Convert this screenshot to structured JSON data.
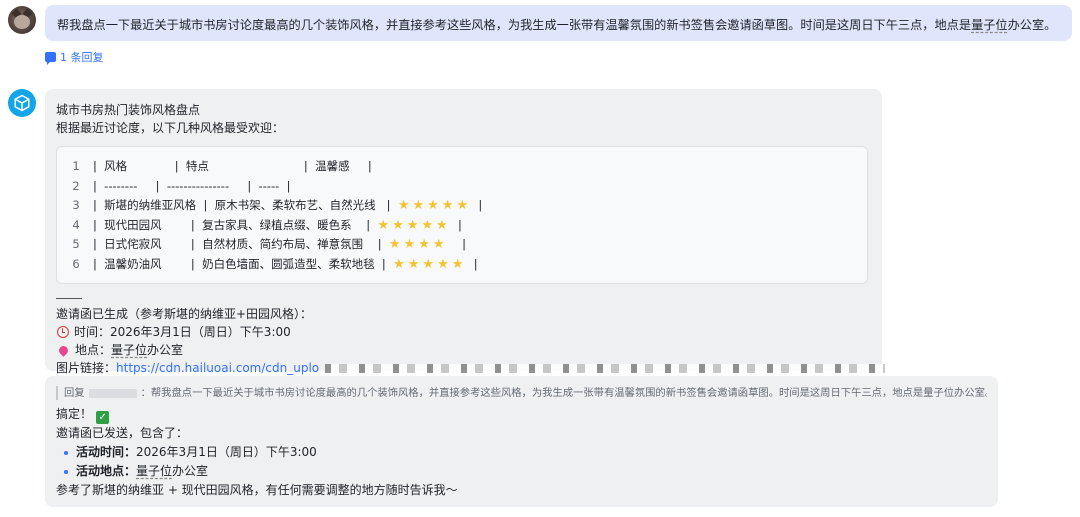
{
  "user_message": {
    "text_before": "帮我盘点一下最近关于城市书房讨论度最高的几个装饰风格，并直接参考这些风格，为我生成一张带有温馨氛围的新书签售会邀请函草图。时间是这周日下午三点，地点是",
    "location": "量子位",
    "location_tail": "办公室。",
    "reply_count": "1 条回复"
  },
  "bot_message": {
    "title": "城市书房热门装饰风格盘点",
    "intro": "根据最近讨论度，以下几种风格最受欢迎：",
    "table_lines": [
      {
        "n": "1",
        "text": "|  风格             |  特点                          |  温馨感     |",
        "stars": ""
      },
      {
        "n": "2",
        "text": "|  --------     |  ---------------     |  -----  |",
        "stars": ""
      },
      {
        "n": "3",
        "text": "|  斯堪的纳维亚风格  |  原木书架、柔软布艺、自然光线   |  ",
        "stars": "★★★★★",
        "tail": "  |"
      },
      {
        "n": "4",
        "text": "|  现代田园风        |  复古家具、绿植点缀、暖色系    |  ",
        "stars": "★★★★★",
        "tail": "  |"
      },
      {
        "n": "5",
        "text": "|  日式侘寂风        |  自然材质、简约布局、禅意氛围    |  ",
        "stars": "★★★★",
        "tail": "    |"
      },
      {
        "n": "6",
        "text": "|  温馨奶油风        |  奶白色墙面、圆弧造型、柔软地毯  |  ",
        "stars": "★★★★★",
        "tail": "  |"
      }
    ],
    "generated": "邀请函已生成（参考斯堪的纳维亚+田园风格）：",
    "time": "时间：2026年3月1日（周日）下午3:00",
    "place_label": "地点：",
    "place_u": "量子位",
    "place_tail": "办公室",
    "image_link_label": "图片链接：",
    "image_link": "https://cdn.hailuoai.com/cdn_uplo"
  },
  "reply_message": {
    "quote_label": "回复",
    "quote_text": "：帮我盘点一下最近关于城市书房讨论度最高的几个装饰风格，并直接参考这些风格，为我生成一张带有温馨氛围的新书签售会邀请函草图。时间是这周日下午三点，地点是量子位办公室。",
    "done": "搞定！",
    "sent": "邀请函已发送，包含了：",
    "b1_label": "活动时间：",
    "b1_value": "2026年3月1日（周日）下午3:00",
    "b2_label": "活动地点：",
    "b2_u": "量子位",
    "b2_tail": "办公室",
    "closing": "参考了斯堪的纳维亚 + 现代田园风格，有任何需要调整的地方随时告诉我～"
  }
}
